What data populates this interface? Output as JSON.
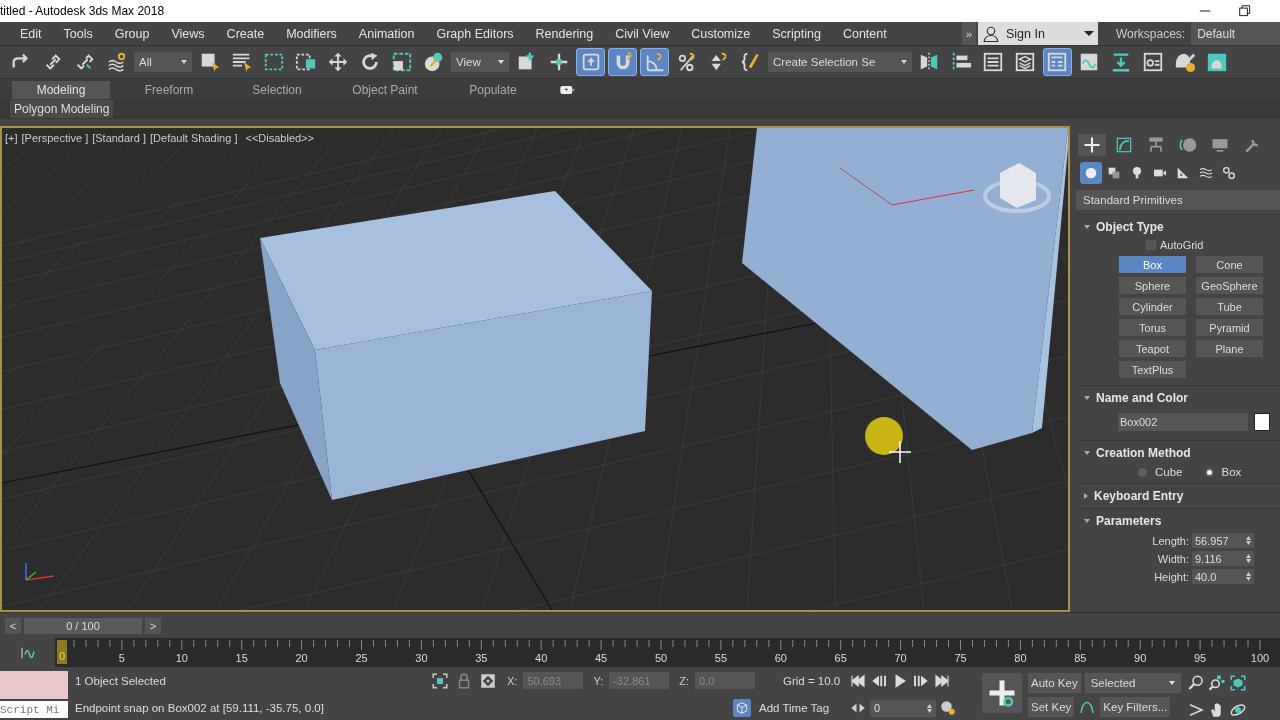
{
  "window": {
    "title": "titled - Autodesk 3ds Max 2018"
  },
  "menu_bar": {
    "items": [
      "Edit",
      "Tools",
      "Group",
      "Views",
      "Create",
      "Modifiers",
      "Animation",
      "Graph Editors",
      "Rendering",
      "Civil View",
      "Customize",
      "Scripting",
      "Content"
    ],
    "overflow": "»",
    "sign_in": "Sign In",
    "workspaces_label": "Workspaces:",
    "workspace": "Default"
  },
  "main_toolbar": [
    {
      "kind": "button",
      "selected": false
    },
    {
      "kind": "button",
      "selected": false
    },
    {
      "kind": "button",
      "selected": false
    },
    {
      "kind": "button",
      "selected": false
    },
    {
      "kind": "dropdown",
      "value": "All"
    },
    {
      "kind": "button",
      "selected": false
    },
    {
      "kind": "button",
      "selected": false
    },
    {
      "kind": "button",
      "selected": false
    },
    {
      "kind": "button",
      "selected": false
    },
    {
      "kind": "button",
      "selected": false
    },
    {
      "kind": "button",
      "selected": false
    },
    {
      "kind": "button",
      "selected": false
    },
    {
      "kind": "button",
      "selected": false
    },
    {
      "kind": "dropdown",
      "value": "View"
    },
    {
      "kind": "button",
      "selected": false
    },
    {
      "kind": "button",
      "selected": false
    },
    {
      "kind": "button",
      "selected": true
    },
    {
      "kind": "button",
      "selected": true
    },
    {
      "kind": "button",
      "selected": true
    },
    {
      "kind": "button",
      "selected": false
    },
    {
      "kind": "button",
      "selected": false
    },
    {
      "kind": "button",
      "selected": false
    },
    {
      "kind": "dropdown",
      "value": "Create Selection Se"
    },
    {
      "kind": "button",
      "selected": false
    },
    {
      "kind": "button",
      "selected": false
    },
    {
      "kind": "button",
      "selected": false
    },
    {
      "kind": "button",
      "selected": false
    },
    {
      "kind": "button",
      "selected": true
    },
    {
      "kind": "button",
      "selected": false
    },
    {
      "kind": "button",
      "selected": false
    },
    {
      "kind": "button",
      "selected": false
    },
    {
      "kind": "button",
      "selected": false
    },
    {
      "kind": "button",
      "selected": false
    }
  ],
  "ribbon": {
    "tabs": [
      {
        "label": "Modeling",
        "selected": true
      },
      {
        "label": "Freeform",
        "selected": false
      },
      {
        "label": "Selection",
        "selected": false
      },
      {
        "label": "Object Paint",
        "selected": false
      },
      {
        "label": "Populate",
        "selected": false
      }
    ],
    "panel": "Polygon Modeling"
  },
  "viewport": {
    "labels": [
      "[+]",
      "[Perspective ]",
      "[Standard ]",
      "[Default Shading ]",
      "<<Disabled>>"
    ]
  },
  "command_panel": {
    "tabs": [
      {
        "selected": true
      },
      {
        "selected": false
      },
      {
        "selected": false
      },
      {
        "selected": false
      },
      {
        "selected": false
      },
      {
        "selected": false
      }
    ],
    "categories": [
      {
        "selected": true
      },
      {
        "selected": false
      },
      {
        "selected": false
      },
      {
        "selected": false
      },
      {
        "selected": false
      },
      {
        "selected": false
      },
      {
        "selected": false
      }
    ],
    "dropdown": "Standard Primitives",
    "rollouts": [
      {
        "kind": "object_type",
        "title": "Object Type",
        "expanded": true,
        "autogrid": {
          "label": "AutoGrid",
          "checked": false
        },
        "buttons": [
          {
            "label": "Box",
            "selected": true
          },
          {
            "label": "Cone",
            "selected": false
          },
          {
            "label": "Sphere",
            "selected": false
          },
          {
            "label": "GeoSphere",
            "selected": false
          },
          {
            "label": "Cylinder",
            "selected": false
          },
          {
            "label": "Tube",
            "selected": false
          },
          {
            "label": "Torus",
            "selected": false
          },
          {
            "label": "Pyramid",
            "selected": false
          },
          {
            "label": "Teapot",
            "selected": false
          },
          {
            "label": "Plane",
            "selected": false
          },
          {
            "label": "TextPlus",
            "selected": false
          }
        ]
      },
      {
        "kind": "name_color",
        "title": "Name and Color",
        "expanded": true,
        "name": "Box002",
        "color": "#ffffff"
      },
      {
        "kind": "radio",
        "title": "Creation Method",
        "expanded": true,
        "options": [
          {
            "label": "Cube",
            "selected": false
          },
          {
            "label": "Box",
            "selected": true
          }
        ]
      },
      {
        "kind": "empty",
        "title": "Keyboard Entry",
        "expanded": false
      },
      {
        "kind": "params",
        "title": "Parameters",
        "expanded": true,
        "fields": [
          {
            "label": "Length:",
            "value": "56.957"
          },
          {
            "label": "Width:",
            "value": "9.116"
          },
          {
            "label": "Height:",
            "value": "40.0"
          }
        ]
      }
    ]
  },
  "time_slider": {
    "prev": "<",
    "position": "0 / 100",
    "level": 0,
    "next": ">"
  },
  "track_bar": {
    "ticks": [
      {
        "label": "0",
        "selected": true
      },
      {
        "label": "5",
        "selected": false
      },
      {
        "label": "10",
        "selected": false
      },
      {
        "label": "15",
        "selected": false
      },
      {
        "label": "20",
        "selected": false
      },
      {
        "label": "25",
        "selected": false
      },
      {
        "label": "30",
        "selected": false
      },
      {
        "label": "35",
        "selected": false
      },
      {
        "label": "40",
        "selected": false
      },
      {
        "label": "45",
        "selected": false
      },
      {
        "label": "50",
        "selected": false
      },
      {
        "label": "55",
        "selected": false
      },
      {
        "label": "60",
        "selected": false
      },
      {
        "label": "65",
        "selected": false
      },
      {
        "label": "70",
        "selected": false
      },
      {
        "label": "75",
        "selected": false
      },
      {
        "label": "80",
        "selected": false
      },
      {
        "label": "85",
        "selected": false
      },
      {
        "label": "90",
        "selected": false
      },
      {
        "label": "95",
        "selected": false
      },
      {
        "label": "100",
        "selected": false
      }
    ]
  },
  "status_bar": {
    "listener": "Script Mi",
    "selection": "1 Object Selected",
    "prompt": "Endpoint snap on Box002 at [59.111, -35.75, 0.0]",
    "coords": [
      {
        "label": "X:",
        "value": "50.693",
        "disabled": true
      },
      {
        "label": "Y:",
        "value": "-32.861",
        "disabled": true
      },
      {
        "label": "Z:",
        "value": "0.0",
        "disabled": true
      }
    ],
    "grid": "Grid = 10.0",
    "time_tag": "Add Time Tag",
    "frame": "0",
    "auto_key": "Auto Key",
    "key_mode": "Selected",
    "set_key": "Set Key",
    "key_filters": "Key Filters..."
  }
}
